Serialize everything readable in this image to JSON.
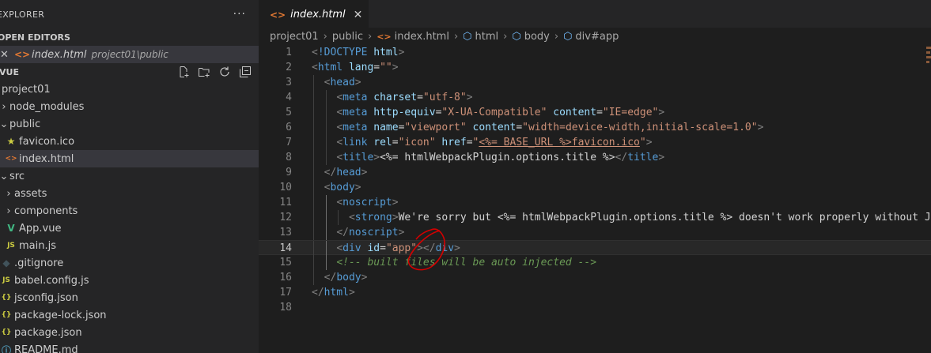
{
  "sidebar": {
    "explorer_title": "EXPLORER",
    "more_actions_label": "···",
    "open_editors_title": "OPEN EDITORS",
    "open_editor": {
      "close": "✕",
      "name": "index.html",
      "path": "project01\\public"
    },
    "workspace_title": "VUE",
    "tree": [
      {
        "label": "project01",
        "depth": 0,
        "chevron": "",
        "icon": ""
      },
      {
        "label": "node_modules",
        "depth": 0,
        "chevron": "›",
        "icon": ""
      },
      {
        "label": "public",
        "depth": 0,
        "chevron": "⌄",
        "icon": ""
      },
      {
        "label": "favicon.ico",
        "depth": 1,
        "chevron": "",
        "icon": "★"
      },
      {
        "label": "index.html",
        "depth": 1,
        "chevron": "",
        "icon": "<>"
      },
      {
        "label": "src",
        "depth": 0,
        "chevron": "⌄",
        "icon": ""
      },
      {
        "label": "assets",
        "depth": 1,
        "chevron": "›",
        "icon": ""
      },
      {
        "label": "components",
        "depth": 1,
        "chevron": "›",
        "icon": ""
      },
      {
        "label": "App.vue",
        "depth": 1,
        "chevron": "",
        "icon": "V"
      },
      {
        "label": "main.js",
        "depth": 1,
        "chevron": "",
        "icon": "JS"
      },
      {
        "label": ".gitignore",
        "depth": 0,
        "chevron": "",
        "icon": "◆"
      },
      {
        "label": "babel.config.js",
        "depth": 0,
        "chevron": "",
        "icon": "JS"
      },
      {
        "label": "jsconfig.json",
        "depth": 0,
        "chevron": "",
        "icon": "{}"
      },
      {
        "label": "package-lock.json",
        "depth": 0,
        "chevron": "",
        "icon": "{}"
      },
      {
        "label": "package.json",
        "depth": 0,
        "chevron": "",
        "icon": "{}"
      },
      {
        "label": "README.md",
        "depth": 0,
        "chevron": "",
        "icon": "ⓘ"
      }
    ]
  },
  "editor": {
    "tab": {
      "icon": "<>",
      "label": "index.html",
      "close": "✕"
    },
    "breadcrumb": [
      "project01",
      "public",
      "index.html",
      "html",
      "body",
      "div#app"
    ],
    "current_line": 14,
    "lines": [
      {
        "n": "1",
        "parts": [
          [
            "punct",
            "<"
          ],
          [
            "tag",
            "!DOCTYPE"
          ],
          [
            "plain",
            " "
          ],
          [
            "attr",
            "html"
          ],
          [
            "punct",
            ">"
          ]
        ]
      },
      {
        "n": "2",
        "parts": [
          [
            "punct",
            "<"
          ],
          [
            "tag",
            "html"
          ],
          [
            "plain",
            " "
          ],
          [
            "attr",
            "lang"
          ],
          [
            "plain",
            "="
          ],
          [
            "str",
            "\"\""
          ],
          [
            "punct",
            ">"
          ]
        ]
      },
      {
        "n": "3",
        "parts": [
          [
            "plain",
            "  "
          ],
          [
            "punct",
            "<"
          ],
          [
            "tag",
            "head"
          ],
          [
            "punct",
            ">"
          ]
        ]
      },
      {
        "n": "4",
        "parts": [
          [
            "plain",
            "    "
          ],
          [
            "punct",
            "<"
          ],
          [
            "tag",
            "meta"
          ],
          [
            "plain",
            " "
          ],
          [
            "attr",
            "charset"
          ],
          [
            "plain",
            "="
          ],
          [
            "str",
            "\"utf-8\""
          ],
          [
            "punct",
            ">"
          ]
        ]
      },
      {
        "n": "5",
        "parts": [
          [
            "plain",
            "    "
          ],
          [
            "punct",
            "<"
          ],
          [
            "tag",
            "meta"
          ],
          [
            "plain",
            " "
          ],
          [
            "attr",
            "http-equiv"
          ],
          [
            "plain",
            "="
          ],
          [
            "str",
            "\"X-UA-Compatible\""
          ],
          [
            "plain",
            " "
          ],
          [
            "attr",
            "content"
          ],
          [
            "plain",
            "="
          ],
          [
            "str",
            "\"IE=edge\""
          ],
          [
            "punct",
            ">"
          ]
        ]
      },
      {
        "n": "6",
        "parts": [
          [
            "plain",
            "    "
          ],
          [
            "punct",
            "<"
          ],
          [
            "tag",
            "meta"
          ],
          [
            "plain",
            " "
          ],
          [
            "attr",
            "name"
          ],
          [
            "plain",
            "="
          ],
          [
            "str",
            "\"viewport\""
          ],
          [
            "plain",
            " "
          ],
          [
            "attr",
            "content"
          ],
          [
            "plain",
            "="
          ],
          [
            "str",
            "\"width=device-width,initial-scale=1.0\""
          ],
          [
            "punct",
            ">"
          ]
        ]
      },
      {
        "n": "7",
        "parts": [
          [
            "plain",
            "    "
          ],
          [
            "punct",
            "<"
          ],
          [
            "tag",
            "link"
          ],
          [
            "plain",
            " "
          ],
          [
            "attr",
            "rel"
          ],
          [
            "plain",
            "="
          ],
          [
            "str",
            "\"icon\""
          ],
          [
            "plain",
            " "
          ],
          [
            "attr",
            "href"
          ],
          [
            "plain",
            "="
          ],
          [
            "str",
            "\""
          ],
          [
            "strul",
            "<%= BASE_URL %>favicon.ico"
          ],
          [
            "str",
            "\""
          ],
          [
            "punct",
            ">"
          ]
        ]
      },
      {
        "n": "8",
        "parts": [
          [
            "plain",
            "    "
          ],
          [
            "punct",
            "<"
          ],
          [
            "tag",
            "title"
          ],
          [
            "punct",
            ">"
          ],
          [
            "plain",
            "<%= htmlWebpackPlugin.options.title %>"
          ],
          [
            "punct",
            "</"
          ],
          [
            "tag",
            "title"
          ],
          [
            "punct",
            ">"
          ]
        ]
      },
      {
        "n": "9",
        "parts": [
          [
            "plain",
            "  "
          ],
          [
            "punct",
            "</"
          ],
          [
            "tag",
            "head"
          ],
          [
            "punct",
            ">"
          ]
        ]
      },
      {
        "n": "10",
        "parts": [
          [
            "plain",
            "  "
          ],
          [
            "punct",
            "<"
          ],
          [
            "tag",
            "body"
          ],
          [
            "punct",
            ">"
          ]
        ]
      },
      {
        "n": "11",
        "parts": [
          [
            "plain",
            "    "
          ],
          [
            "punct",
            "<"
          ],
          [
            "tag",
            "noscript"
          ],
          [
            "punct",
            ">"
          ]
        ]
      },
      {
        "n": "12",
        "parts": [
          [
            "plain",
            "      "
          ],
          [
            "punct",
            "<"
          ],
          [
            "tag",
            "strong"
          ],
          [
            "punct",
            ">"
          ],
          [
            "plain",
            "We're sorry but <%= htmlWebpackPlugin.options.title %> doesn't work properly without J"
          ]
        ]
      },
      {
        "n": "13",
        "parts": [
          [
            "plain",
            "    "
          ],
          [
            "punct",
            "</"
          ],
          [
            "tag",
            "noscript"
          ],
          [
            "punct",
            ">"
          ]
        ]
      },
      {
        "n": "14",
        "parts": [
          [
            "plain",
            "    "
          ],
          [
            "punct",
            "<"
          ],
          [
            "tag",
            "div"
          ],
          [
            "plain",
            " "
          ],
          [
            "attr",
            "id"
          ],
          [
            "plain",
            "="
          ],
          [
            "str",
            "\"app\""
          ],
          [
            "punct",
            "></"
          ],
          [
            "tag",
            "div"
          ],
          [
            "punct",
            ">"
          ]
        ]
      },
      {
        "n": "15",
        "parts": [
          [
            "plain",
            "    "
          ],
          [
            "cmt",
            "<!-- built files will be auto injected -->"
          ]
        ]
      },
      {
        "n": "16",
        "parts": [
          [
            "plain",
            "  "
          ],
          [
            "punct",
            "</"
          ],
          [
            "tag",
            "body"
          ],
          [
            "punct",
            ">"
          ]
        ]
      },
      {
        "n": "17",
        "parts": [
          [
            "punct",
            "</"
          ],
          [
            "tag",
            "html"
          ],
          [
            "punct",
            ">"
          ]
        ]
      },
      {
        "n": "18",
        "parts": []
      }
    ]
  },
  "colors": {
    "sidebar_bg": "#252526",
    "editor_bg": "#1e1e1e",
    "selection_bg": "#37373d",
    "tag": "#569cd6",
    "attribute": "#9cdcfe",
    "string": "#ce9178",
    "comment": "#6a9955",
    "html_icon": "#e37933",
    "annotation_circle": "#d40000"
  }
}
